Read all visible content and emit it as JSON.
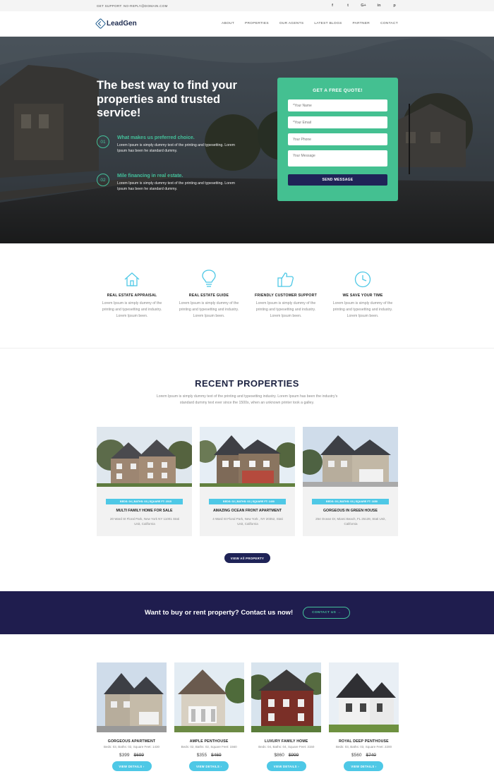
{
  "topbar": {
    "support": "GET SUPPORT: NO-REPLY@DOMAIN.COM",
    "social_icons": [
      "facebook-icon",
      "twitter-icon",
      "google-plus-icon",
      "linkedin-icon",
      "pinterest-icon"
    ],
    "social_glyphs": [
      "f",
      "t",
      "G+",
      "in",
      "p"
    ]
  },
  "nav": {
    "logo": "LeadGen",
    "items": [
      "ABOUT",
      "PROPERTIES",
      "OUR AGENTS",
      "LATEST BLOGS",
      "PARTNER",
      "CONTACT"
    ]
  },
  "hero": {
    "title": "The best way to find your properties and trusted service!",
    "features": [
      {
        "num": "01",
        "title": "What makes us preferred choice.",
        "desc": "Lorem Ipsum is simply dummy text of the printing and typesetting. Lorem Ipsum has been he standard dummy."
      },
      {
        "num": "02",
        "title": "Mile financing in real estate.",
        "desc": "Lorem Ipsum is simply dummy text of the printing and typesetting. Lorem Ipsum has been he standard dummy."
      }
    ]
  },
  "quote": {
    "title": "GET A FREE QUOTE!",
    "name_placeholder": "*Your Name",
    "email_placeholder": "*Your Email",
    "phone_placeholder": "Your Phone",
    "message_placeholder": "Your Message",
    "button": "SEND MESSAGE"
  },
  "services": [
    {
      "icon": "house-icon",
      "title": "REAL ESTATE APPRAISAL",
      "desc": "Lorem Ipsum is simply dummy of the printing and typesetting and industry. Lorem Ipsum been."
    },
    {
      "icon": "lightbulb-icon",
      "title": "REAL ESTATE GUIDE",
      "desc": "Lorem Ipsum is simply dummy of the printing and typesetting and industry. Lorem Ipsum been."
    },
    {
      "icon": "thumbs-up-icon",
      "title": "FRIENDLY CUSTOMER SUPPORT",
      "desc": "Lorem Ipsum is simply dummy of the printing and typesetting and industry. Lorem Ipsum been."
    },
    {
      "icon": "clock-icon",
      "title": "WE SAVE YOUR TIME",
      "desc": "Lorem Ipsum is simply dummy of the printing and typesetting and industry. Lorem Ipsum been."
    }
  ],
  "recent": {
    "title": "RECENT PROPERTIES",
    "subtitle": "Lorem Ipsum is simply dummy text of the printing and typesetting industry. Lorem Ipsum has been the industry's standard dummy text ever since the 1500s, when an unknown printer took a galley.",
    "cards": [
      {
        "spec": "BEDS: 04  |  BATHS: 03  |  SQUARE FT: 2015",
        "title": "MULTI FAMILY HOME FOR SALE",
        "address": "20 Ward St Floral Park, New York NY 11001 Stati Unit, California"
      },
      {
        "spec": "BEDS: 02  |  BATHS: 02  |  SQUARE FT: 1400",
        "title": "AMAZING OCEAN FRONT APARTMENT",
        "address": "4 Ward St Floral Park, New York , NY 20352, Stati Unit, California"
      },
      {
        "spec": "BEDS: 03  |  BATHS: 03  |  SQUARE FT: 1650",
        "title": "GORGEOUS IN GREEN HOUSE",
        "address": "254 Ocean Dr, Miami Beach, FL 25139, Stati Unit, California"
      }
    ],
    "view_all": "VIEW All PROPERTY"
  },
  "cta": {
    "text": "Want to buy or rent property? Contact us now!",
    "button": "CONTACT US →"
  },
  "listings": [
    {
      "title": "GORGEOUS APARTMENT",
      "details": "Beds: 03, Baths: 02, Square Feet: 1430",
      "price": "$399",
      "old_price": "$699",
      "button": "VIEW DETAILS ›"
    },
    {
      "title": "AMPLE PENTHOUSE",
      "details": "Beds: 02, Baths: 02, Square Feet: 1560",
      "price": "$355",
      "old_price": "$469",
      "button": "VIEW DETAILS ›"
    },
    {
      "title": "LUXURY FAMILY HOME",
      "details": "Beds: 04, Baths: 04, Square Feet: 3150",
      "price": "$860",
      "old_price": "$999",
      "button": "VIEW DETAILS ›"
    },
    {
      "title": "ROYAL DEEP PENTHOUSE",
      "details": "Beds: 03, Baths: 03, Square Feet: 2200",
      "price": "$560",
      "old_price": "$740",
      "button": "VIEW DETAILS ›"
    }
  ],
  "colors": {
    "accent_green": "#44c091",
    "navy": "#1f2357",
    "cyan": "#4ec8e6"
  }
}
